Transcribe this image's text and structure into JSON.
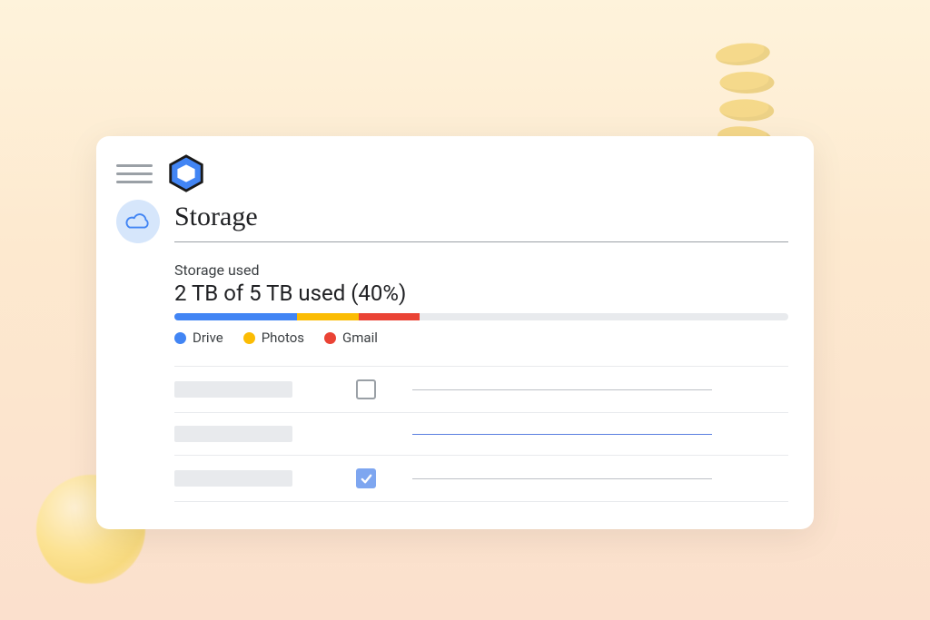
{
  "page": {
    "title": "Storage",
    "usage_label": "Storage used",
    "usage_text": "2 TB of 5 TB used (40%)"
  },
  "colors": {
    "drive": "#4285f4",
    "photos": "#fbbc04",
    "gmail": "#ea4335",
    "track": "#e8eaed"
  },
  "chart_data": {
    "type": "bar",
    "title": "Storage used",
    "total_tb": 5,
    "used_tb": 2,
    "used_percent": 40,
    "series": [
      {
        "name": "Drive",
        "percent_of_total": 20
      },
      {
        "name": "Photos",
        "percent_of_total": 10
      },
      {
        "name": "Gmail",
        "percent_of_total": 10
      }
    ],
    "categories": [
      "Drive",
      "Photos",
      "Gmail"
    ],
    "xlabel": "",
    "ylabel": "",
    "ylim": [
      0,
      100
    ]
  },
  "legend": {
    "drive": "Drive",
    "photos": "Photos",
    "gmail": "Gmail"
  },
  "settings_rows": [
    {
      "checkbox_checked": false,
      "has_checkbox": true,
      "link_style": "gray"
    },
    {
      "checkbox_checked": false,
      "has_checkbox": false,
      "link_style": "blue"
    },
    {
      "checkbox_checked": true,
      "has_checkbox": true,
      "link_style": "gray"
    }
  ]
}
